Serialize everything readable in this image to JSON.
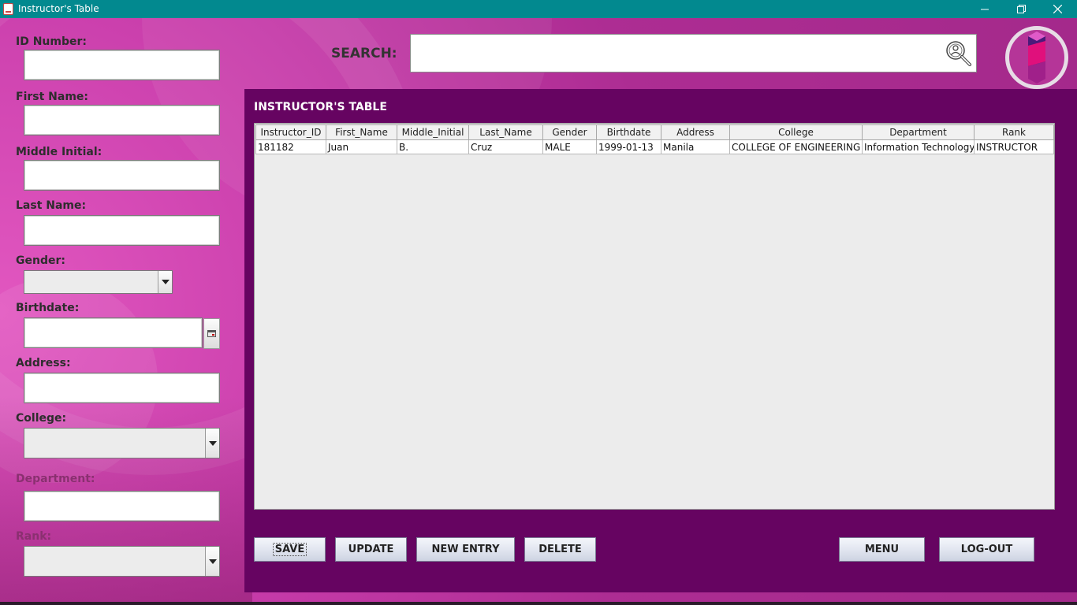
{
  "window": {
    "title": "Instructor's Table"
  },
  "form": {
    "id_label": "ID Number:",
    "first_label": "First Name:",
    "middle_label": "Middle Initial:",
    "last_label": "Last Name:",
    "gender_label": "Gender:",
    "birthdate_label": "Birthdate:",
    "address_label": "Address:",
    "college_label": "College:",
    "department_label": "Department:",
    "rank_label": "Rank:"
  },
  "search": {
    "label": "SEARCH:"
  },
  "panel": {
    "title": "INSTRUCTOR'S TABLE"
  },
  "table": {
    "columns": [
      "Instructor_ID",
      "First_Name",
      "Middle_Initial",
      "Last_Name",
      "Gender",
      "Birthdate",
      "Address",
      "College",
      "Department",
      "Rank"
    ],
    "rows": [
      [
        "181182",
        "Juan",
        "B.",
        "Cruz",
        "MALE",
        "1999-01-13",
        "Manila",
        "COLLEGE OF ENGINEERING",
        "Information Technology",
        "INSTRUCTOR"
      ]
    ]
  },
  "buttons": {
    "save": "SAVE",
    "update": "UPDATE",
    "new_entry": "NEW ENTRY",
    "delete": "DELETE",
    "menu": "MENU",
    "logout": "LOG-OUT"
  },
  "icons": [
    "java-app-icon",
    "minimize-icon",
    "restore-icon",
    "close-icon",
    "search-icon",
    "calendar-icon",
    "chevron-down-icon",
    "logo-icon"
  ],
  "colors": {
    "titlebar": "#02898f",
    "panel": "#660461",
    "background": "#b02a8e"
  }
}
